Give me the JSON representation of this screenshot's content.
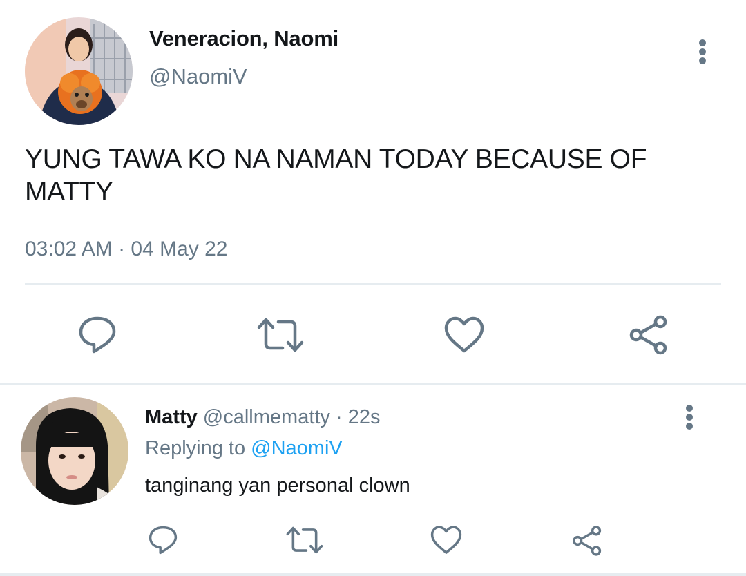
{
  "main_tweet": {
    "display_name": "Veneracion, Naomi",
    "handle": "@NaomiV",
    "text": "YUNG TAWA KO NA NAMAN TODAY BECAUSE OF MATTY",
    "timestamp": "03:02 AM · 04 May 22",
    "actions": [
      "reply-icon",
      "retweet-icon",
      "like-icon",
      "share-icon"
    ]
  },
  "reply_tweet": {
    "display_name": "Matty",
    "handle": "@callmematty",
    "time": "· 22s",
    "replying_prefix": "Replying to",
    "replying_to": "@NaomiV",
    "text": "tanginang yan personal clown",
    "actions": [
      "reply-icon",
      "retweet-icon",
      "like-icon",
      "share-icon"
    ]
  },
  "colors": {
    "text_primary": "#14171a",
    "text_secondary": "#657786",
    "link": "#1da1f2",
    "divider": "#e6ecf0"
  }
}
